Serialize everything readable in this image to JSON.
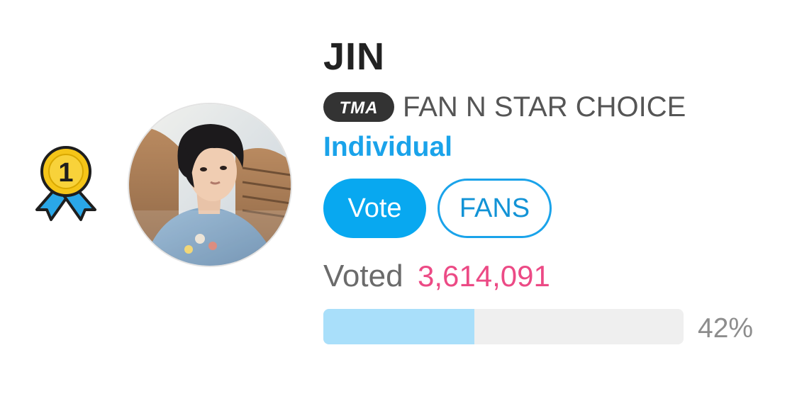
{
  "artist": {
    "name": "JIN",
    "rank": "1",
    "photo": "artist-photo"
  },
  "category": {
    "badge": "TMA",
    "title": "FAN N STAR CHOICE",
    "subtitle": "Individual"
  },
  "actions": {
    "vote_label": "Vote",
    "fans_label": "FANS"
  },
  "votes": {
    "label": "Voted",
    "count": "3,614,091",
    "percent_label": "42%",
    "percent": 42
  },
  "colors": {
    "accent": "#08a8f0",
    "vote_count": "#ec4a85",
    "progress_fill": "#a9dffa",
    "progress_track": "#efefef",
    "medal_gold": "#f5c518",
    "medal_ribbon": "#2aa7e8"
  },
  "icons": {
    "rank": "rank-medal-icon",
    "tma": "tma-logo-icon"
  }
}
